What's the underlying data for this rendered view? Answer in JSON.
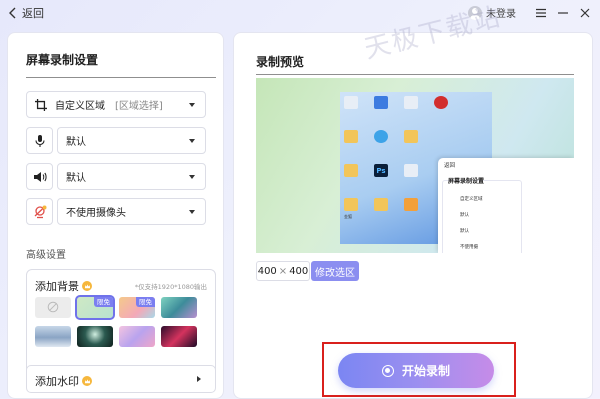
{
  "topbar": {
    "back_label": "返回",
    "user_label": "未登录"
  },
  "settings": {
    "title": "屏幕录制设置",
    "region": {
      "value": "自定义区域",
      "hint": "[区域选择]"
    },
    "microphone": {
      "value": "默认"
    },
    "speaker": {
      "value": "默认"
    },
    "camera": {
      "value": "不使用摄像头"
    },
    "advanced_label": "高级设置",
    "background": {
      "title": "添加背景",
      "note": "*仅支持1920*1080输出",
      "thumbnails": [
        {
          "name": "none",
          "color": "#ececec",
          "badge": ""
        },
        {
          "name": "green-gradient",
          "color": "#cfe9c4",
          "badge": "限免"
        },
        {
          "name": "warm-gradient",
          "color": "#f5c98a",
          "badge": "限免"
        },
        {
          "name": "teal-abstract",
          "color": "#5fb5b3",
          "badge": ""
        },
        {
          "name": "mountains",
          "color": "#a9bfd6",
          "badge": ""
        },
        {
          "name": "dark-green-light",
          "color": "#1f3a35",
          "badge": ""
        },
        {
          "name": "pastel-wave",
          "color": "#d9a7dc",
          "badge": ""
        },
        {
          "name": "dark-red-wave",
          "color": "#5b1a3a",
          "badge": ""
        }
      ]
    },
    "watermark": {
      "title": "添加水印"
    }
  },
  "preview": {
    "title": "录制预览",
    "width": "400",
    "height": "400",
    "size_separator": "×",
    "modify_label": "修改选区",
    "mini_app": {
      "back_label": "返回",
      "title": "屏幕录制设置",
      "row1": "自定义区域",
      "row2": "默认",
      "row3": "默认",
      "row4": "不使用摄"
    },
    "desktop_labels": [
      "金狐",
      "Ps",
      "天极下载站"
    ]
  },
  "record": {
    "label": "开始录制"
  },
  "watermark_text": "天极下载站",
  "colors": {
    "accent": "#8b8ef0",
    "record_gradient_start": "#7b86f2",
    "record_gradient_end": "#c68ce8",
    "highlight_outline": "#d9201c"
  }
}
